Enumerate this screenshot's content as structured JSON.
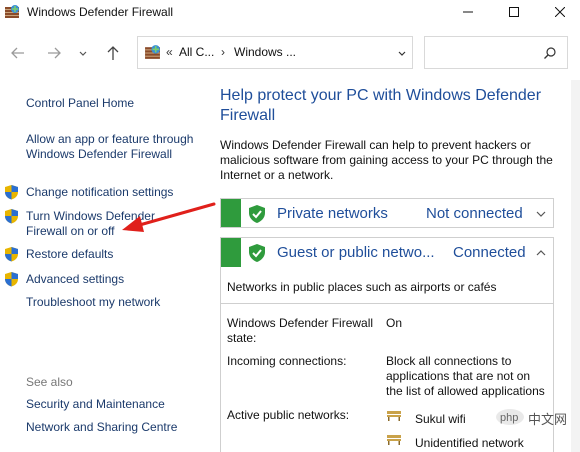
{
  "window": {
    "title": "Windows Defender Firewall"
  },
  "address": {
    "separator": "«",
    "crumb_1": "All C...",
    "crumb_sep": "›",
    "crumb_2": "Windows ..."
  },
  "search": {
    "placeholder": ""
  },
  "sidebar": {
    "home": "Control Panel Home",
    "items": [
      {
        "label": "Allow an app or feature through Windows Defender Firewall",
        "icon": "none"
      },
      {
        "label": "Change notification settings",
        "icon": "uac-shield-icon"
      },
      {
        "label": "Turn Windows Defender Firewall on or off",
        "icon": "uac-shield-icon"
      },
      {
        "label": "Restore defaults",
        "icon": "uac-shield-icon"
      },
      {
        "label": "Advanced settings",
        "icon": "uac-shield-icon"
      },
      {
        "label": "Troubleshoot my network",
        "icon": "none"
      }
    ],
    "see_also_heading": "See also",
    "see_also": [
      "Security and Maintenance",
      "Network and Sharing Centre"
    ]
  },
  "main": {
    "title": "Help protect your PC with Windows Defender Firewall",
    "description": "Windows Defender Firewall can help to prevent hackers or malicious software from gaining access to your PC through the Internet or a network.",
    "private_network": {
      "name": "Private networks",
      "status": "Not connected",
      "expanded": false
    },
    "public_network": {
      "name": "Guest or public netwo...",
      "status": "Connected",
      "expanded": true,
      "summary": "Networks in public places such as airports or cafés",
      "details": [
        {
          "label": "Windows Defender Firewall state:",
          "value": "On"
        },
        {
          "label": "Incoming connections:",
          "value": "Block all connections to applications that are not on the list of allowed applications"
        },
        {
          "label": "Active public networks:",
          "value": ""
        }
      ],
      "active_networks": [
        "Sukul wifi",
        "Unidentified network"
      ]
    }
  },
  "colors": {
    "link": "#1b3a6b",
    "heading": "#1f4e9a",
    "green": "#2f9b3d",
    "annotation_red": "#e0201b"
  },
  "watermark": {
    "text": "中文网"
  }
}
